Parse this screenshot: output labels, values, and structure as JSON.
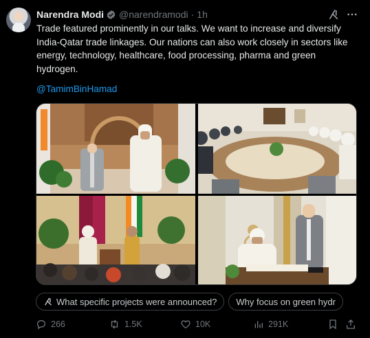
{
  "author": {
    "name": "Narendra Modi",
    "handle": "@narendramodi",
    "separator": "·",
    "time": "1h"
  },
  "post": {
    "line1": "Trade featured prominently in our talks. We want to increase and diversify",
    "line2": "India-Qatar trade linkages. Our nations can also work closely in sectors like",
    "line3": "energy, technology, healthcare, food processing, pharma and green",
    "line4": "hydrogen.",
    "mention": "@TamimBinHamad"
  },
  "media": {
    "photos": [
      {
        "icon": "photo-welcome-ceremony"
      },
      {
        "icon": "photo-delegation-meeting"
      },
      {
        "icon": "photo-reception"
      },
      {
        "icon": "photo-guestbook-signing"
      }
    ]
  },
  "grok_suggestions": [
    "What specific projects were announced?",
    "Why focus on green hydr"
  ],
  "metrics": {
    "replies": "266",
    "reposts": "1.5K",
    "likes": "10K",
    "views": "291K"
  },
  "colors": {
    "background": "#000000",
    "text": "#e7e9ea",
    "muted": "#71767b",
    "link": "#1d9bf0",
    "verified": "#71767b"
  },
  "icons": [
    "verified-badge-icon",
    "grok-icon",
    "more-icon",
    "reply-icon",
    "repost-icon",
    "like-icon",
    "views-icon",
    "bookmark-icon",
    "share-icon"
  ]
}
